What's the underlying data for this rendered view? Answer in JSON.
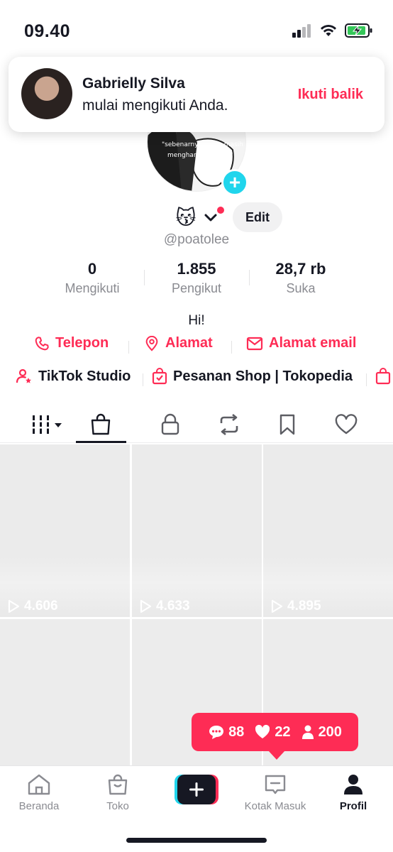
{
  "status_bar": {
    "time": "09.40"
  },
  "notification": {
    "name": "Gabrielly Silva",
    "message": "mulai mengikuti Anda.",
    "action": "Ikuti balik"
  },
  "profile": {
    "avatar_text": "\"sebenarnya diriku masih mengharap kan mu\"",
    "emoji": "😽",
    "edit_label": "Edit",
    "username": "@poatolee",
    "bio": "Hi!"
  },
  "stats": [
    {
      "value": "0",
      "label": "Mengikuti"
    },
    {
      "value": "1.855",
      "label": "Pengikut"
    },
    {
      "value": "28,7 rb",
      "label": "Suka"
    }
  ],
  "links": [
    {
      "label": "Telepon",
      "icon": "phone-icon"
    },
    {
      "label": "Alamat",
      "icon": "location-pin-icon"
    },
    {
      "label": "Alamat email",
      "icon": "mail-icon"
    }
  ],
  "tools": [
    {
      "label": "TikTok Studio",
      "icon": "person-star-icon"
    },
    {
      "label": "Pesanan Shop | Tokopedia",
      "icon": "shopping-bag-check-icon"
    }
  ],
  "tabs": [
    {
      "name": "videos",
      "icon": "grid-bars-icon"
    },
    {
      "name": "shop",
      "icon": "shopping-bag-icon",
      "active": true
    },
    {
      "name": "private",
      "icon": "lock-icon"
    },
    {
      "name": "reposts",
      "icon": "repost-icon"
    },
    {
      "name": "favorites",
      "icon": "bookmark-icon"
    },
    {
      "name": "liked",
      "icon": "heart-icon"
    }
  ],
  "videos": [
    {
      "views": "4.606"
    },
    {
      "views": "4.633"
    },
    {
      "views": "4.895"
    }
  ],
  "activity": {
    "comments": "88",
    "likes": "22",
    "followers": "200"
  },
  "bottom_nav": [
    {
      "label": "Beranda",
      "icon": "home-icon"
    },
    {
      "label": "Toko",
      "icon": "shop-bag-icon"
    },
    {
      "label": "",
      "icon": "create-plus-icon"
    },
    {
      "label": "Kotak Masuk",
      "icon": "inbox-icon"
    },
    {
      "label": "Profil",
      "icon": "profile-icon",
      "active": true
    }
  ],
  "colors": {
    "accent": "#fe2c55",
    "cyan": "#20d5ec",
    "text": "#161823",
    "muted": "#8a8b91"
  }
}
